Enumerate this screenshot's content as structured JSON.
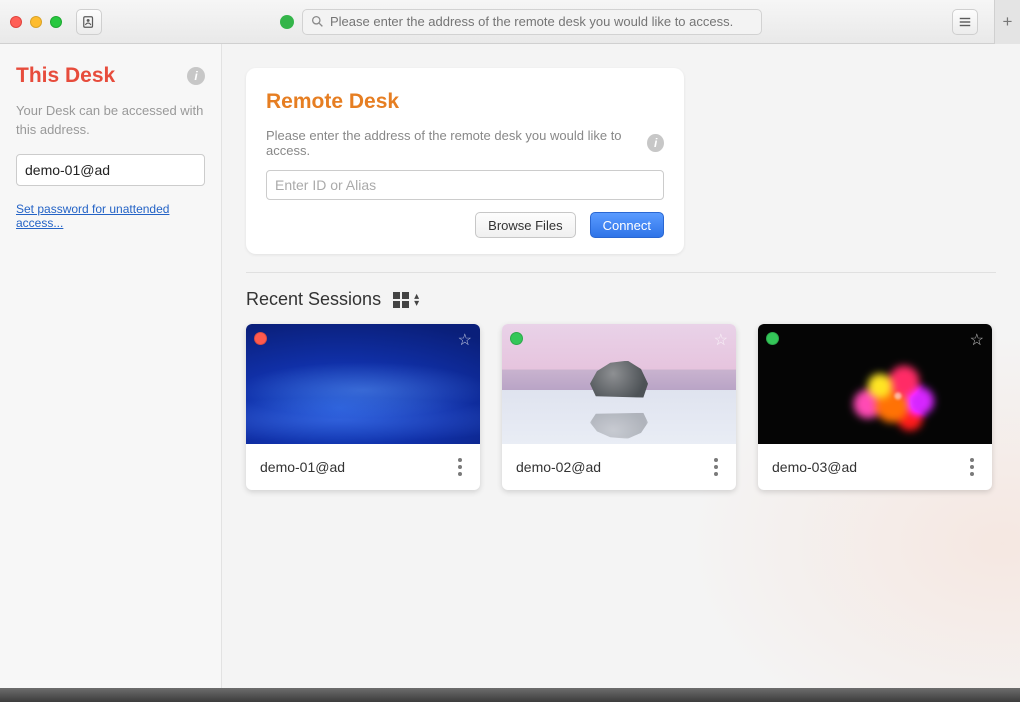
{
  "titlebar": {
    "search_placeholder": "Please enter the address of the remote desk you would like to access."
  },
  "sidebar": {
    "title": "This Desk",
    "description": "Your Desk can be accessed with this address.",
    "own_id": "demo-01@ad",
    "set_password_link": "Set password for unattended access..."
  },
  "remote": {
    "title": "Remote Desk",
    "description": "Please enter the address of the remote desk you would like to access.",
    "input_placeholder": "Enter ID or Alias",
    "browse_label": "Browse Files",
    "connect_label": "Connect"
  },
  "recent": {
    "title": "Recent Sessions",
    "items": [
      {
        "name": "demo-01@ad",
        "status": "red"
      },
      {
        "name": "demo-02@ad",
        "status": "green"
      },
      {
        "name": "demo-03@ad",
        "status": "green"
      }
    ]
  }
}
